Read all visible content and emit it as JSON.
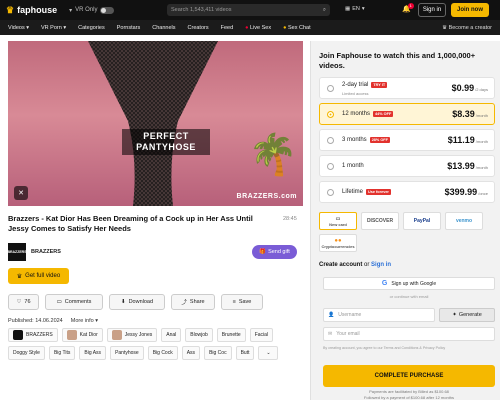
{
  "header": {
    "logo_text": "faphouse",
    "vr_only": "VR Only",
    "search_placeholder": "Search 1,543,411 videos",
    "lang": "EN",
    "notif_count": "1",
    "signin": "Sign in",
    "join": "Join now"
  },
  "nav": {
    "items": [
      "Videos",
      "VR Porn",
      "Categories",
      "Pornstars",
      "Channels",
      "Creators",
      "Feed",
      "Live Sex",
      "Sex Chat"
    ],
    "become_creator": "Become a creator"
  },
  "player": {
    "caption_line1": "PERFECT",
    "caption_line2": "PANTYHOSE",
    "watermark": "BRAZZERS.com"
  },
  "video": {
    "title": "Brazzers - Kat Dior Has Been Dreaming of a Cock up in Her Ass Until Jessy Comes to Satisfy Her Needs",
    "duration": "28:45",
    "channel_name": "BRAZZERS",
    "channel_logo": "BRAZZERS",
    "send_gift": "Send gift",
    "get_full": "Get full video",
    "likes": "76",
    "comments": "Comments",
    "download": "Download",
    "share": "Share",
    "save": "Save",
    "published": "Published: 14.06.2024",
    "more_info": "More info",
    "tags": [
      "BRAZZERS",
      "Kat Dior",
      "Jessy Jones",
      "Anal",
      "Blowjob",
      "Brunette",
      "Facial",
      "Doggy Style",
      "Big Tits",
      "Big Ass",
      "Pantyhose",
      "Big Cock",
      "Ass",
      "Big Coc",
      "Butt"
    ]
  },
  "panel": {
    "heading": "Join Faphouse to watch this and 1,000,000+ videos.",
    "plans": [
      {
        "name": "2-day trial",
        "badge": "TRY IT",
        "sub": "Limited access",
        "price": "$0.99",
        "per": "/2 days"
      },
      {
        "name": "12 months",
        "badge": "44% OFF",
        "sub": "",
        "price": "$8.39",
        "per": "/month"
      },
      {
        "name": "3 months",
        "badge": "28% OFF",
        "sub": "",
        "price": "$11.19",
        "per": "/month"
      },
      {
        "name": "1 month",
        "badge": "",
        "sub": "",
        "price": "$13.99",
        "per": "/month"
      },
      {
        "name": "Lifetime",
        "badge": "Use forever",
        "sub": "",
        "price": "$399.99",
        "per": "/once"
      }
    ],
    "selected_plan": 1,
    "payments": [
      "New card",
      "DISCOVER",
      "PayPal",
      "venmo",
      "Cryptocurrencies"
    ],
    "create_account": "Create account",
    "or": "or",
    "sign_in": "Sign in",
    "google": "Sign up with Google",
    "or_continue": "or continue with email",
    "username_placeholder": "Username",
    "generate": "Generate",
    "email_placeholder": "Your email",
    "terms": "By creating account, you agree to our Terms and Conditions & Privacy Policy",
    "purchase": "COMPLETE PURCHASE",
    "fine_line1": "Payments are facilitated by Billed as $100.68",
    "fine_line2": "Followed by a payment of $100.68 after 12 months"
  },
  "colors": {
    "accent": "#f5b800",
    "gift": "#7a5cd6",
    "badge": "#e2322d"
  }
}
